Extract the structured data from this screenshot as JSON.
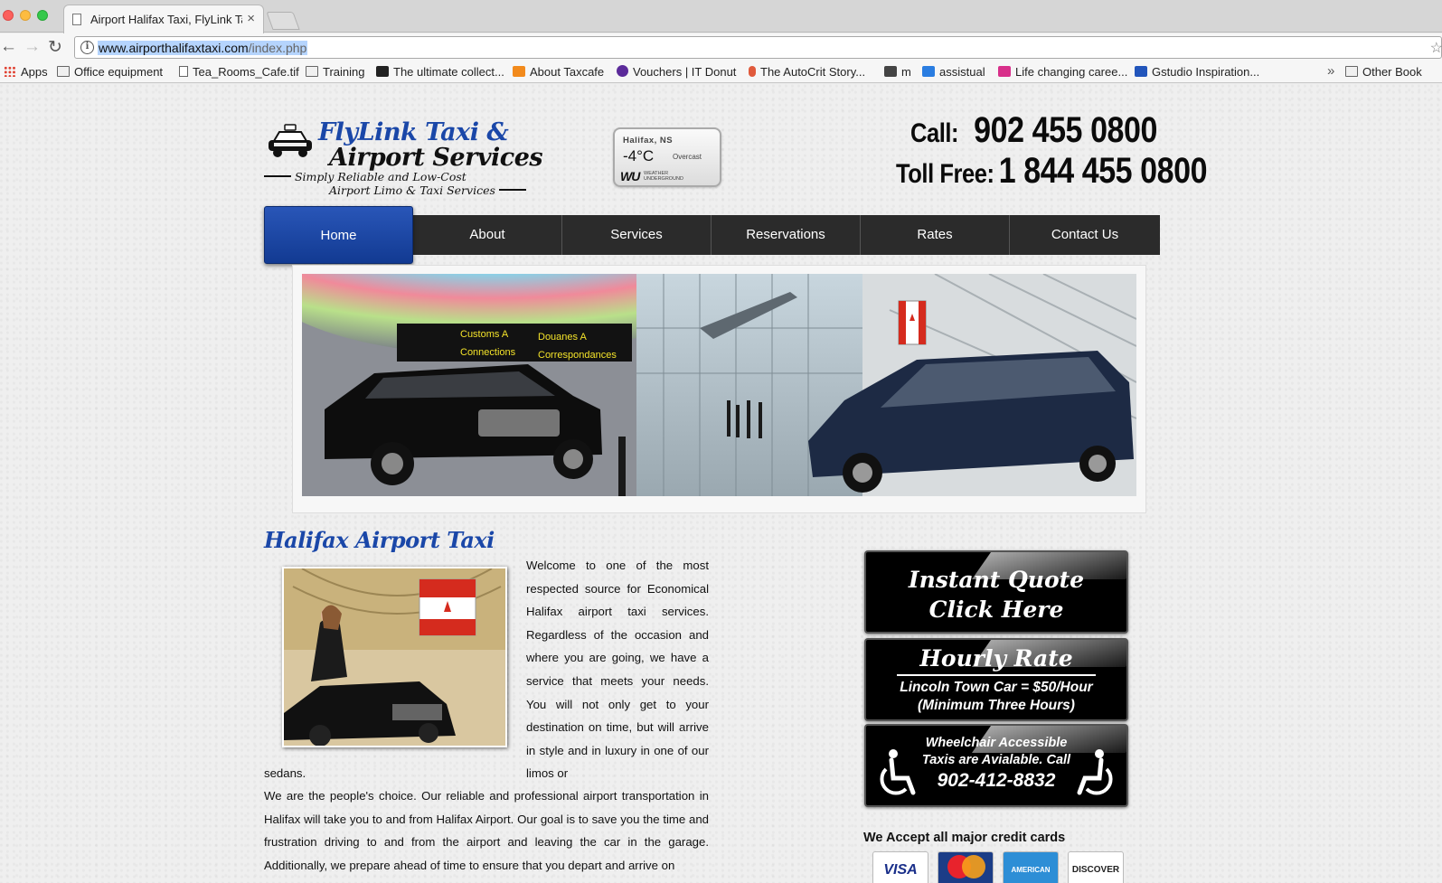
{
  "browser": {
    "tab_title": "Airport Halifax Taxi, FlyLink Ta",
    "url_host": "www.airporthalifaxtaxi.com",
    "url_path": "/index.php",
    "bookmarks": [
      {
        "label": "Apps",
        "icon": "apps-grid-icon"
      },
      {
        "label": "Office equipment",
        "icon": "folder-icon"
      },
      {
        "label": "Tea_Rooms_Cafe.tif",
        "icon": "document-icon"
      },
      {
        "label": "Training",
        "icon": "folder-icon"
      },
      {
        "label": "The ultimate collect...",
        "icon": "cb-site-icon"
      },
      {
        "label": "About Taxcafe",
        "icon": "taxcafe-icon"
      },
      {
        "label": "Vouchers | IT Donut",
        "icon": "it-donut-icon"
      },
      {
        "label": "The AutoCrit Story...",
        "icon": "autocrit-icon"
      },
      {
        "label": "m",
        "icon": "box-icon"
      },
      {
        "label": "assistual",
        "icon": "assistual-icon"
      },
      {
        "label": "Life changing caree...",
        "icon": "careers-icon"
      },
      {
        "label": "Gstudio Inspiration...",
        "icon": "gstudio-icon"
      },
      {
        "label": "Other Book",
        "icon": "folder-icon"
      }
    ]
  },
  "header": {
    "logo_line1": "FlyLink Taxi &",
    "logo_line2": "Airport Services",
    "logo_tag1": "Simply Reliable and Low-Cost",
    "logo_tag2": "Airport Limo & Taxi Services",
    "weather_city": "Halifax, NS",
    "weather_temp": "-4°C",
    "weather_cond": "Overcast",
    "weather_brand": "WU",
    "weather_brand_text": "WEATHER UNDERGROUND",
    "call_label": "Call:",
    "call_number": "902 455 0800",
    "tollfree_label": "Toll Free:",
    "tollfree_number": "1 844 455 0800"
  },
  "nav": [
    "Home",
    "About",
    "Services",
    "Reservations",
    "Rates",
    "Contact Us"
  ],
  "banner": {
    "sign_customs": "Customs A",
    "sign_douanes": "Douanes A",
    "sign_connections": "Connections",
    "sign_correspondances": "Correspondances"
  },
  "main": {
    "heading": "Halifax Airport Taxi",
    "para1": "Welcome to one of the most respected source for Economical Halifax airport taxi services. Regardless of the occasion and where you are going, we have a service that meets your needs. You will not only get to your destination on time, but will arrive in style and in luxury in one of our limos or",
    "para1_end": "sedans.",
    "para2": "We are the people's choice. Our reliable and professional airport transportation in Halifax will take you to and from Halifax Airport. Our goal is to save you the time and frustration driving to and from the airport and leaving the car in the garage. Additionally, we prepare ahead of time to ensure that you depart and arrive on"
  },
  "sidebar": {
    "quote_line1": "Instant Quote",
    "quote_line2": "Click Here",
    "hourly_title": "Hourly Rate",
    "hourly_line1": "Lincoln Town Car = $50/Hour",
    "hourly_line2": "(Minimum Three Hours)",
    "wc_line1": "Wheelchair Accessible",
    "wc_line2": "Taxis are Avialable. Call",
    "wc_phone": "902-412-8832",
    "cards_title": "We Accept all major credit cards",
    "cards": [
      "VISA",
      "MasterCard",
      "AMERICAN EXPRESS",
      "DISCOVER"
    ]
  }
}
